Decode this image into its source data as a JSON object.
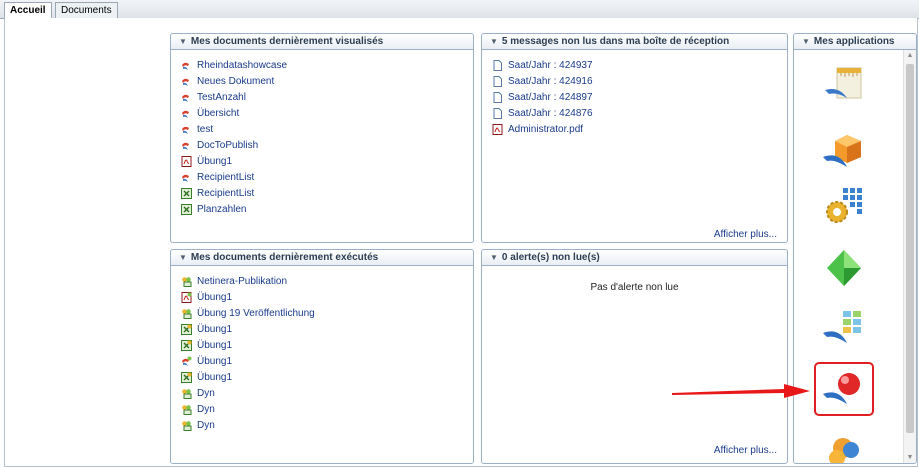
{
  "tabs": [
    {
      "label": "Accueil",
      "active": true
    },
    {
      "label": "Documents",
      "active": false
    }
  ],
  "recent_viewed": {
    "title": "Mes documents dernièrement visualisés",
    "items": [
      {
        "label": "Rheindatashowcase",
        "icon": "webi-doc-icon"
      },
      {
        "label": "Neues Dokument",
        "icon": "webi-doc-icon"
      },
      {
        "label": "TestAnzahl",
        "icon": "webi-doc-icon"
      },
      {
        "label": "Übersicht",
        "icon": "webi-doc-icon"
      },
      {
        "label": "test",
        "icon": "webi-doc-icon"
      },
      {
        "label": "DocToPublish",
        "icon": "webi-doc-icon"
      },
      {
        "label": "Übung1",
        "icon": "pdf-doc-icon"
      },
      {
        "label": "RecipientList",
        "icon": "webi-doc-icon"
      },
      {
        "label": "RecipientList",
        "icon": "excel-doc-icon"
      },
      {
        "label": "Planzahlen",
        "icon": "excel-doc-icon"
      }
    ]
  },
  "inbox": {
    "title": "5 messages non lus dans ma boîte de réception",
    "items": [
      {
        "label": "Saat/Jahr : 424937",
        "icon": "text-file-icon"
      },
      {
        "label": "Saat/Jahr : 424916",
        "icon": "text-file-icon"
      },
      {
        "label": "Saat/Jahr : 424897",
        "icon": "text-file-icon"
      },
      {
        "label": "Saat/Jahr : 424876",
        "icon": "text-file-icon"
      },
      {
        "label": "Administrator.pdf",
        "icon": "pdf-file-icon"
      }
    ],
    "more": "Afficher plus..."
  },
  "recent_run": {
    "title": "Mes documents dernièrement exécutés",
    "items": [
      {
        "label": "Netinera-Publikation",
        "icon": "publication-icon"
      },
      {
        "label": "Übung1",
        "icon": "pdf-instance-icon"
      },
      {
        "label": "Übung 19 Veröffentlichung",
        "icon": "publication-icon"
      },
      {
        "label": "Übung1",
        "icon": "excel-instance-icon"
      },
      {
        "label": "Übung1",
        "icon": "excel-instance-icon"
      },
      {
        "label": "Übung1",
        "icon": "webi-instance-icon"
      },
      {
        "label": "Übung1",
        "icon": "excel-instance-icon"
      },
      {
        "label": "Dyn",
        "icon": "publication-icon"
      },
      {
        "label": "Dyn",
        "icon": "publication-icon"
      },
      {
        "label": "Dyn",
        "icon": "publication-icon"
      }
    ]
  },
  "alerts": {
    "title": "0 alerte(s) non lue(s)",
    "empty_text": "Pas d'alerte non lue",
    "more": "Afficher plus..."
  },
  "apps": {
    "title": "Mes applications",
    "items": [
      {
        "icon": "report-ruler-app-icon"
      },
      {
        "icon": "orange-cube-app-icon"
      },
      {
        "icon": "gear-grid-app-icon"
      },
      {
        "icon": "green-diamond-app-icon"
      },
      {
        "icon": "module-blocks-app-icon"
      },
      {
        "icon": "red-ball-app-icon",
        "highlighted": true
      },
      {
        "icon": "orange-blue-circles-app-icon"
      }
    ]
  },
  "colors": {
    "link": "#1a3b8b",
    "panel_border": "#9bb0c6",
    "highlight": "#e02020"
  }
}
